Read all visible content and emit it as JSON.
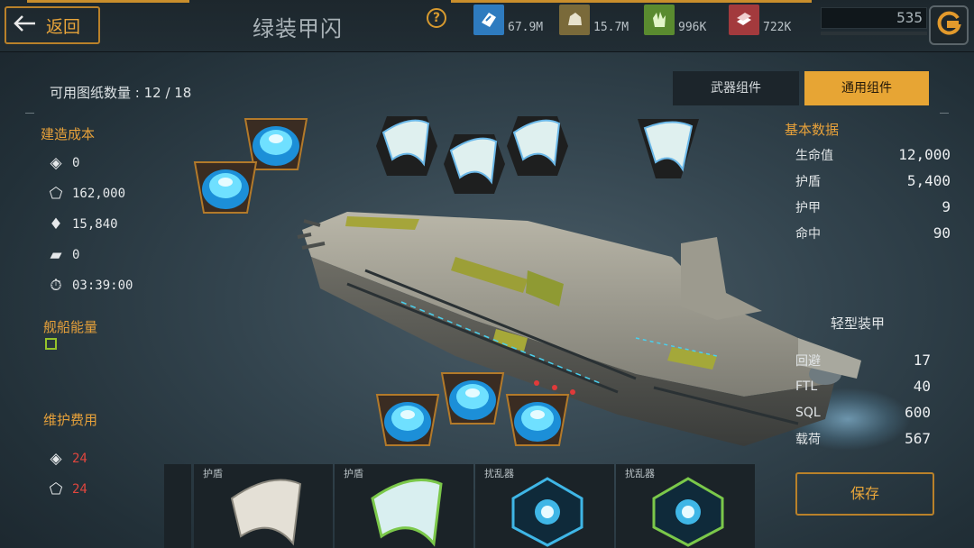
{
  "header": {
    "back_label": "返回",
    "title": "绿装甲闪",
    "help_symbol": "?",
    "resources": [
      {
        "icon": "ore-chip-icon",
        "value": "67.9M",
        "color": "#2e7bbf"
      },
      {
        "icon": "rock-icon",
        "value": "15.7M",
        "color": "#7a6a3a"
      },
      {
        "icon": "crystal-icon",
        "value": "996K",
        "color": "#5a8b2f"
      },
      {
        "icon": "alloy-icon",
        "value": "722K",
        "color": "#a33a3d"
      }
    ],
    "credits": "535"
  },
  "tabs": {
    "blueprint_label": "可用图纸数量 : 12 / 18",
    "weapon": "武器组件",
    "general": "通用组件",
    "active": "general"
  },
  "build_cost": {
    "title": "建造成本",
    "items": [
      {
        "icon": "ore-chip-icon",
        "value": "0"
      },
      {
        "icon": "rock-icon",
        "value": "162,000"
      },
      {
        "icon": "crystal-icon",
        "value": "15,840"
      },
      {
        "icon": "alloy-icon",
        "value": "0"
      },
      {
        "icon": "clock-icon",
        "value": "03:39:00"
      }
    ]
  },
  "ship_energy": {
    "title": "舰船能量",
    "value": "0"
  },
  "maintenance": {
    "title": "维护费用",
    "items": [
      {
        "icon": "ore-chip-icon",
        "value": "24"
      },
      {
        "icon": "rock-icon",
        "value": "24"
      }
    ]
  },
  "base_stats": {
    "title": "基本数据",
    "rows": [
      {
        "label": "生命值",
        "value": "12,000"
      },
      {
        "label": "护盾",
        "value": "5,400"
      },
      {
        "label": "护甲",
        "value": "9"
      },
      {
        "label": "命中",
        "value": "90"
      }
    ]
  },
  "armor_stats": {
    "title": "轻型装甲",
    "rows": [
      {
        "label": "回避",
        "value": "17"
      },
      {
        "label": "FTL",
        "value": "40"
      },
      {
        "label": "SQL",
        "value": "600"
      },
      {
        "label": "载荷",
        "value": "567"
      }
    ]
  },
  "save_label": "保存",
  "inventory": [
    {
      "label": "护盾",
      "icon": "armor-plate-icon"
    },
    {
      "label": "护盾",
      "icon": "green-armor-plate-icon"
    },
    {
      "label": "扰乱器",
      "icon": "jammer-icon"
    },
    {
      "label": "扰乱器",
      "icon": "green-jammer-icon"
    }
  ]
}
